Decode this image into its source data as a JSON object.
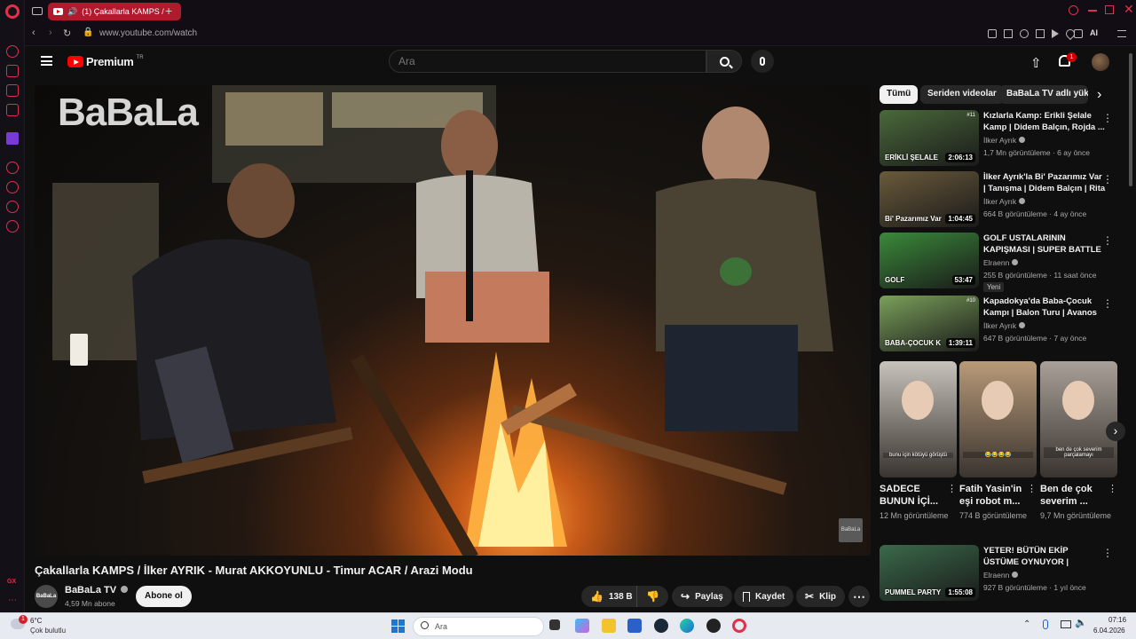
{
  "browser": {
    "tab_title": "(1) Çakallarla KAMPS /",
    "url": "www.youtube.com/watch",
    "ai_label": "AI"
  },
  "youtube": {
    "logo_text": "Premium",
    "logo_sup": "TR",
    "search_placeholder": "Ara",
    "notif_count": "1"
  },
  "video": {
    "watermark": "BaBaLa",
    "title": "Çakallarla KAMPS / İlker AYRIK - Murat AKKOYUNLU - Timur ACAR / Arazi Modu",
    "channel_name": "BaBaLa TV",
    "channel_avatar": "BaBaLa",
    "subscribers": "4,59 Mn abone",
    "subscribe_label": "Abone ol",
    "like_count": "138 B",
    "share_label": "Paylaş",
    "save_label": "Kaydet",
    "clip_label": "Klip"
  },
  "chips": [
    "Tümü",
    "Seriden videolar",
    "BaBaLa TV adlı yükleyiciden"
  ],
  "recommendations": [
    {
      "title": "Kızlarla Kamp: Erikli Şelale Kamp | Didem Balçın, Rojda ...",
      "channel": "İlker Ayrık",
      "meta": "1,7 Mn görüntüleme · 6 ay önce",
      "duration": "2:06:13",
      "thumb_text": "ERİKLİ ŞELALE",
      "tag": "#11",
      "badge": "",
      "color": "#4a6a3a"
    },
    {
      "title": "İlker Ayrık'la Bi' Pazarımız Var | Tanışma | Didem Balçın | Rita ...",
      "channel": "İlker Ayrık",
      "meta": "664 B görüntüleme · 4 ay önce",
      "duration": "1:04:45",
      "thumb_text": "Bi' Pazarımız Var",
      "tag": "",
      "badge": "",
      "color": "#6a5a3a"
    },
    {
      "title": "GOLF USTALARININ KAPIŞMASI | SUPER BATTLE ...",
      "channel": "Elraenn",
      "meta": "255 B görüntüleme · 11 saat önce",
      "duration": "53:47",
      "thumb_text": "GOLF",
      "tag": "",
      "badge": "Yeni",
      "color": "#3a8a3a"
    },
    {
      "title": "Kapadokya'da Baba-Çocuk Kampı | Balon Turu | Avanos v...",
      "channel": "İlker Ayrık",
      "meta": "647 B görüntüleme · 7 ay önce",
      "duration": "1:39:11",
      "thumb_text": "BABA-ÇOCUK K",
      "tag": "#10",
      "badge": "",
      "color": "#7aa05a"
    },
    {
      "title": "YETER! BÜTÜN EKİP ÜSTÜME OYNUYOR | PUMMEL PARTY | ...",
      "channel": "Elraenn",
      "meta": "927 B görüntüleme · 1 yıl önce",
      "duration": "1:55:08",
      "thumb_text": "PUMMEL PARTY",
      "tag": "",
      "badge": "",
      "color": "#3a6a4a"
    }
  ],
  "shorts": [
    {
      "title": "SADECE BUNUN İÇİ...",
      "views": "12 Mn görüntüleme",
      "caption": "bunu için kötüyü görüştü",
      "color": "#c8c2bc"
    },
    {
      "title": "Fatih Yasin'in eşi robot m...",
      "views": "774 B görüntüleme",
      "caption": "😂😂😂😂",
      "color": "#b89a78"
    },
    {
      "title": "Ben de çok severim ...",
      "views": "9,7 Mn görüntüleme",
      "caption": "ben de çok severim parçalamayı",
      "color": "#a8a098"
    }
  ],
  "taskbar": {
    "weather_temp": "6°C",
    "weather_desc": "Çok bulutlu",
    "weather_badge": "1",
    "search_placeholder": "Ara",
    "time": "07:16",
    "date": "6.04.2026"
  }
}
